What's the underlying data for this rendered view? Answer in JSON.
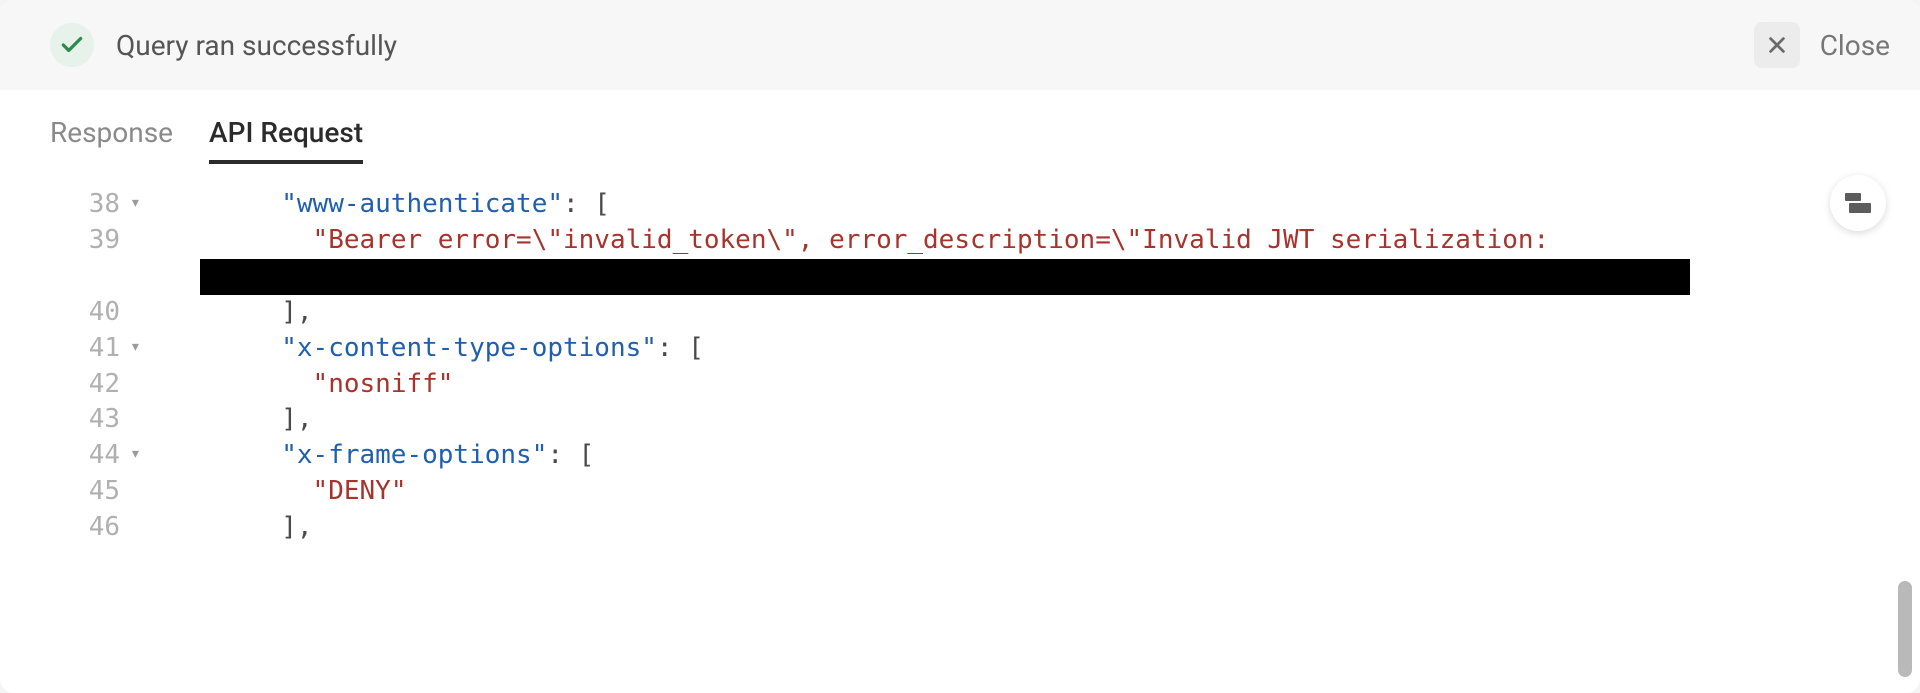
{
  "status": {
    "message": "Query ran successfully"
  },
  "close": {
    "label": "Close"
  },
  "tabs": {
    "response": "Response",
    "apiRequest": "API Request"
  },
  "code": {
    "indent4": "        ",
    "indent5": "          ",
    "lines": [
      {
        "n": "38",
        "fold": "▾",
        "kind": "kv-open",
        "key": "\"www-authenticate\"",
        "sep": ": ["
      },
      {
        "n": "39",
        "fold": "",
        "kind": "str",
        "text": "\"Bearer error=\\\"invalid_token\\\", error_description=\\\"Invalid JWT serialization:"
      },
      {
        "n": "",
        "fold": "",
        "kind": "redact"
      },
      {
        "n": "40",
        "fold": "",
        "kind": "close",
        "text": "],"
      },
      {
        "n": "41",
        "fold": "▾",
        "kind": "kv-open",
        "key": "\"x-content-type-options\"",
        "sep": ": ["
      },
      {
        "n": "42",
        "fold": "",
        "kind": "str",
        "text": "\"nosniff\""
      },
      {
        "n": "43",
        "fold": "",
        "kind": "close",
        "text": "],"
      },
      {
        "n": "44",
        "fold": "▾",
        "kind": "kv-open",
        "key": "\"x-frame-options\"",
        "sep": ": ["
      },
      {
        "n": "45",
        "fold": "",
        "kind": "str",
        "text": "\"DENY\""
      },
      {
        "n": "46",
        "fold": "",
        "kind": "close",
        "text": "],"
      }
    ]
  }
}
